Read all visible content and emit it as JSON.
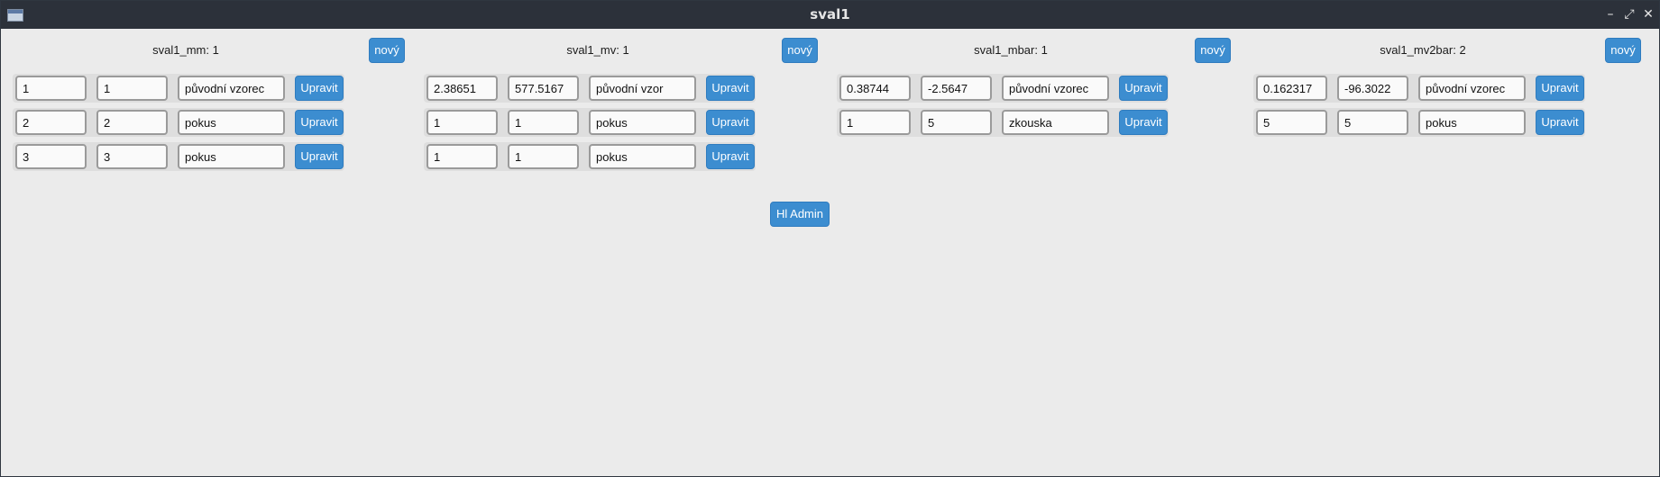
{
  "window": {
    "title": "sval1"
  },
  "colors": {
    "accent": "#3c8dd0",
    "titlebar": "#2c313a",
    "background": "#ebebeb"
  },
  "columns": [
    {
      "header": "sval1_mm: 1",
      "new_label": "nový",
      "rows": [
        {
          "a": "1",
          "b": "1",
          "name": "původní vzorec",
          "edit_label": "Upravit"
        },
        {
          "a": "2",
          "b": "2",
          "name": "pokus",
          "edit_label": "Upravit"
        },
        {
          "a": "3",
          "b": "3",
          "name": "pokus",
          "edit_label": "Upravit"
        }
      ]
    },
    {
      "header": "sval1_mv: 1",
      "new_label": "nový",
      "rows": [
        {
          "a": "2.38651",
          "b": "577.5167",
          "name": "původní vzor",
          "edit_label": "Upravit"
        },
        {
          "a": "1",
          "b": "1",
          "name": "pokus",
          "edit_label": "Upravit"
        },
        {
          "a": "1",
          "b": "1",
          "name": "pokus",
          "edit_label": "Upravit"
        }
      ]
    },
    {
      "header": "sval1_mbar: 1",
      "new_label": "nový",
      "rows": [
        {
          "a": "0.38744",
          "b": "-2.5647",
          "name": "původní vzorec",
          "edit_label": "Upravit"
        },
        {
          "a": "1",
          "b": "5",
          "name": "zkouska",
          "edit_label": "Upravit"
        }
      ]
    },
    {
      "header": "sval1_mv2bar: 2",
      "new_label": "nový",
      "rows": [
        {
          "a": "0.162317",
          "b": "-96.3022",
          "name": "původní vzorec",
          "edit_label": "Upravit"
        },
        {
          "a": "5",
          "b": "5",
          "name": "pokus",
          "edit_label": "Upravit"
        }
      ]
    }
  ],
  "admin_button": "Hl Admin"
}
